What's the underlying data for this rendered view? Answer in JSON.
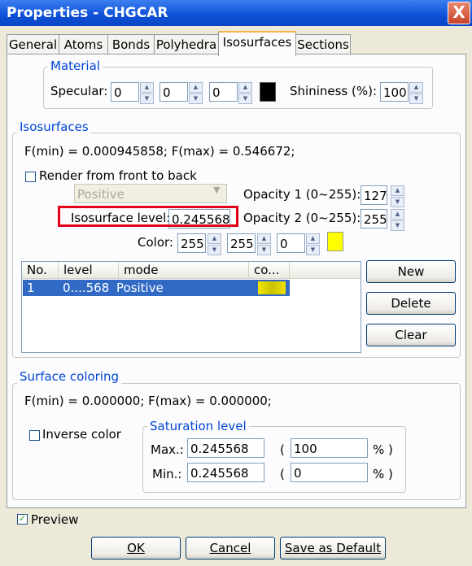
{
  "window": {
    "title": "Properties - CHGCAR",
    "close": "X"
  },
  "tabs": [
    "General",
    "Atoms",
    "Bonds",
    "Polyhedra",
    "Isosurfaces",
    "Sections"
  ],
  "material": {
    "title": "Material",
    "specular_label": "Specular:",
    "specular": [
      "0",
      "0",
      "0"
    ],
    "shininess_label": "Shininess (%):",
    "shininess": "100"
  },
  "isosurfaces": {
    "title": "Isosurfaces",
    "range_text": "F(min) = 0.000945858;   F(max) = 0.546672;",
    "render_front_label": "Render from front to back",
    "mode_select": "Positive",
    "level_label": "Isosurface level:",
    "level_value": "0.245568",
    "opacity1_label": "Opacity 1 (0~255):",
    "opacity1": "127",
    "opacity2_label": "Opacity 2 (0~255):",
    "opacity2": "255",
    "color_label": "Color:",
    "color": [
      "255",
      "255",
      "0"
    ],
    "columns": [
      "No.",
      "level",
      "mode",
      "co..."
    ],
    "rows": [
      {
        "no": "1",
        "level": "0....568",
        "mode": "Positive"
      }
    ],
    "new_btn": "New",
    "delete_btn": "Delete",
    "clear_btn": "Clear"
  },
  "surface": {
    "title": "Surface coloring",
    "range_text": "F(min) = 0.000000;   F(max) = 0.000000;",
    "inverse_label": "Inverse color",
    "saturation_title": "Saturation level",
    "max_label": "Max.:",
    "max_value": "0.245568",
    "max_pct": "100",
    "min_label": "Min.:",
    "min_value": "0.245568",
    "min_pct": "0",
    "paren_open": "(",
    "pct_close": "% )"
  },
  "preview_label": "Preview",
  "buttons": {
    "ok": "OK",
    "cancel": "Cancel",
    "save_default": "Save as Default"
  },
  "colors": {
    "highlight_box": "#e3001b",
    "selection": "#316ac5",
    "swatch_yellow": "#ffff00"
  }
}
